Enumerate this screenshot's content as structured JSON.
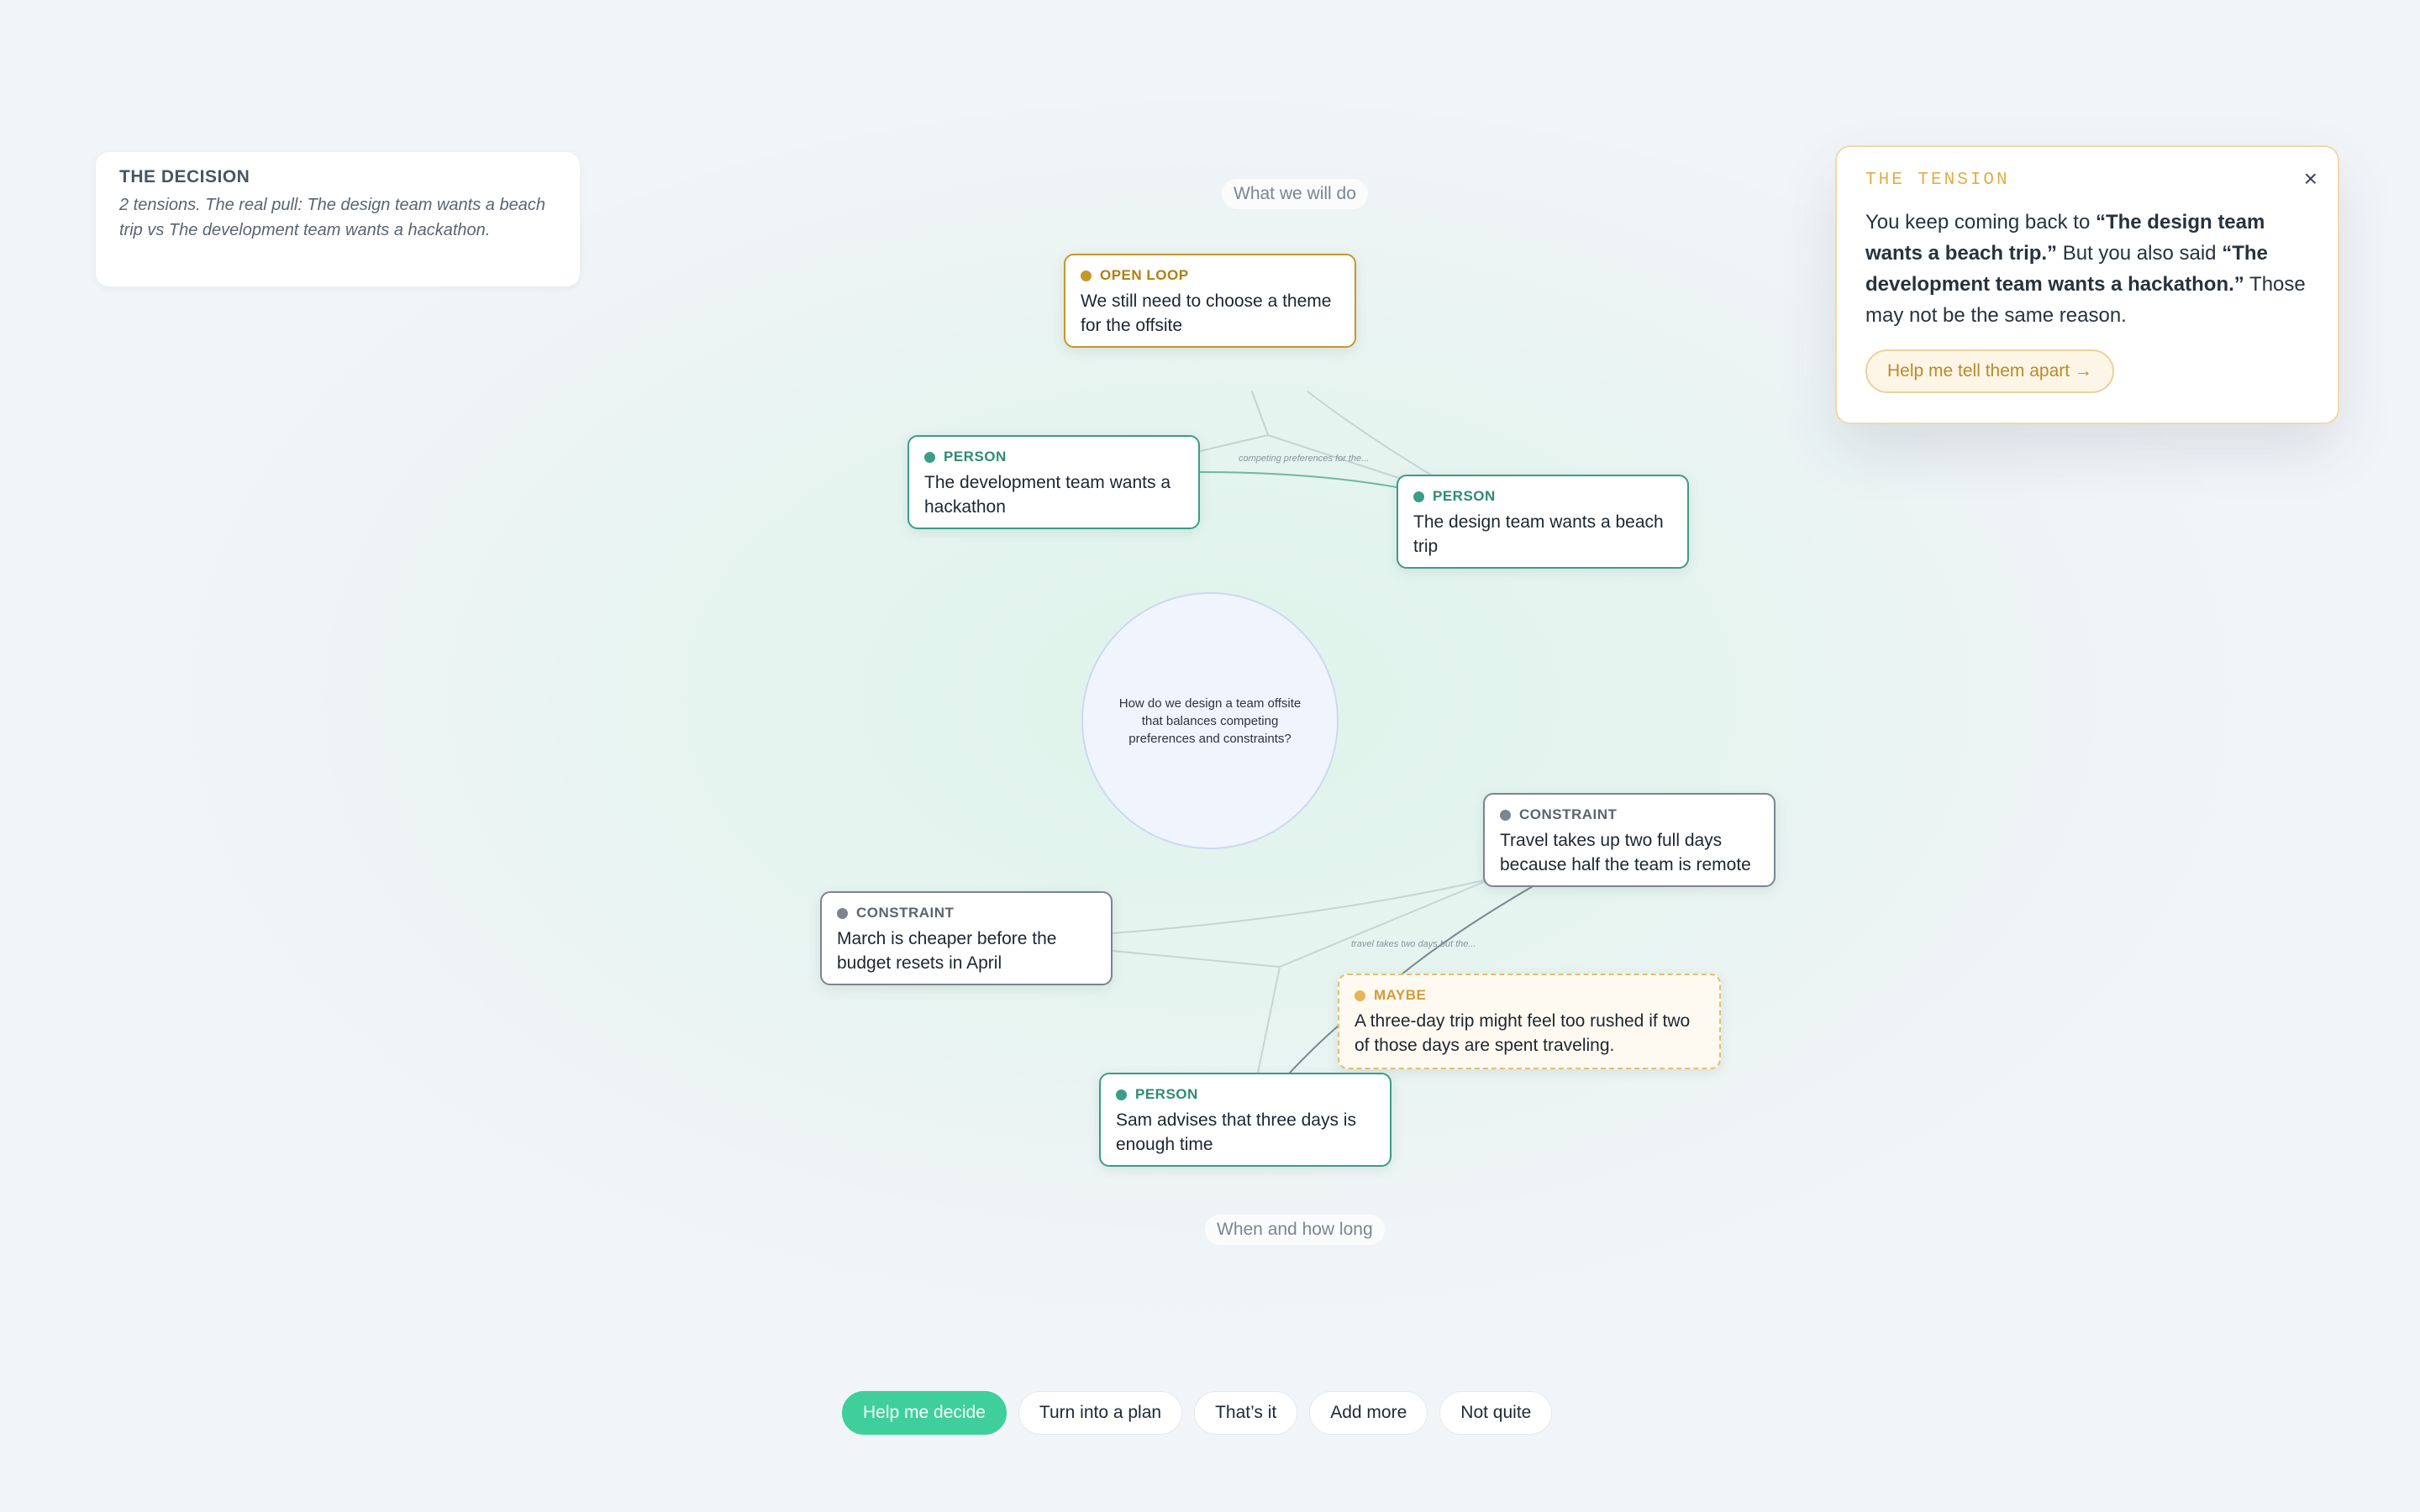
{
  "decision": {
    "heading": "THE DECISION",
    "text": "2 tensions. The real pull: The design team wants a beach trip vs The development team wants a hackathon."
  },
  "sections": {
    "top": "What we will do",
    "bottom": "When and how long"
  },
  "center_question": "How do we design a team offsite that balances competing preferences and constraints?",
  "nodes": {
    "open_loop": {
      "tag": "OPEN LOOP",
      "text": "We still need to choose a theme for the offsite"
    },
    "dev_team": {
      "tag": "PERSON",
      "text": "The development team wants a hackathon"
    },
    "design_team": {
      "tag": "PERSON",
      "text": "The design team wants a beach trip"
    },
    "travel": {
      "tag": "CONSTRAINT",
      "text": "Travel takes up two full days because half the team is remote"
    },
    "march": {
      "tag": "CONSTRAINT",
      "text": "March is cheaper before the budget resets in April"
    },
    "maybe": {
      "tag": "MAYBE",
      "text": "A three-day trip might feel too rushed if two of those days are spent traveling."
    },
    "sam": {
      "tag": "PERSON",
      "text": "Sam advises that three days is enough time"
    }
  },
  "edge_labels": {
    "competing": "competing preferences for the...",
    "travel": "travel takes two days but the..."
  },
  "tension": {
    "heading": "THE TENSION",
    "close": "×",
    "pre": "You keep coming back to ",
    "quote1": "“The design team wants a beach trip.”",
    "mid": " But you also said ",
    "quote2": "“The development team wants a hackathon.”",
    "post": " Those may not be the same reason.",
    "button": "Help me tell them apart →"
  },
  "actions": {
    "help_decide": "Help me decide",
    "turn_into_plan": "Turn into a plan",
    "thats_it": "That’s it",
    "add_more": "Add more",
    "not_quite": "Not quite"
  },
  "colors": {
    "person": "#3a9d86",
    "open_loop": "#c9962a",
    "constraint": "#7d8390",
    "maybe": "#e7bd6c",
    "primary_action": "#3ecf9d"
  }
}
